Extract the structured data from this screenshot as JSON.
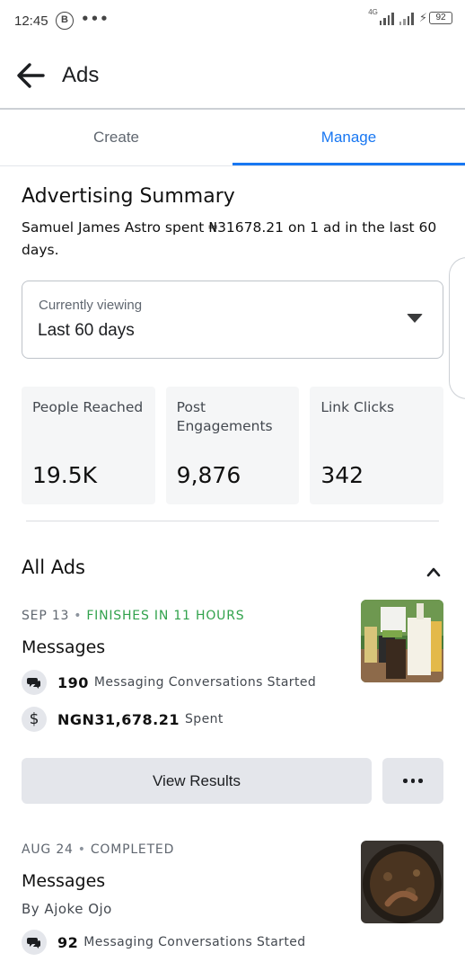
{
  "status_bar": {
    "time": "12:45",
    "b_badge": "B",
    "network": "4G",
    "battery": "92"
  },
  "header": {
    "title": "Ads"
  },
  "tabs": [
    {
      "label": "Create",
      "active": false
    },
    {
      "label": "Manage",
      "active": true
    }
  ],
  "summary": {
    "title": "Advertising Summary",
    "text": "Samuel James Astro spent ₦31678.21 on 1 ad in the last 60 days."
  },
  "viewing": {
    "label": "Currently viewing",
    "value": "Last 60 days"
  },
  "stats": [
    {
      "label": "People Reached",
      "value": "19.5K"
    },
    {
      "label": "Post Engagements",
      "value": "9,876"
    },
    {
      "label": "Link Clicks",
      "value": "342"
    }
  ],
  "all_ads": {
    "title": "All Ads"
  },
  "ads": [
    {
      "date": "SEP 13",
      "status": "FINISHES IN 11 HOURS",
      "name": "Messages",
      "conversations_num": "190",
      "conversations_text": "Messaging Conversations Started",
      "spent_num": "NGN31,678.21",
      "spent_text": "Spent"
    },
    {
      "date": "AUG 24",
      "status": "COMPLETED",
      "name": "Messages",
      "by": "By Ajoke Ojo",
      "conversations_num": "92",
      "conversations_text": "Messaging Conversations Started"
    }
  ],
  "buttons": {
    "view_results": "View Results"
  },
  "colors": {
    "accent": "#1877f2",
    "green_status": "#31a24c",
    "card_bg": "#f5f6f7",
    "button_bg": "#e4e6eb"
  }
}
